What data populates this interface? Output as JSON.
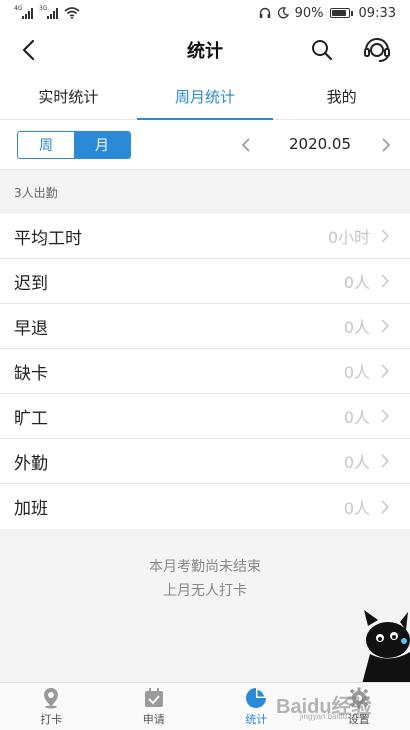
{
  "status_bar": {
    "network_1": "4G",
    "network_2": "3G",
    "battery": "90%",
    "time": "09:33"
  },
  "header": {
    "title": "统计"
  },
  "tabs": [
    {
      "label": "实时统计",
      "active": false
    },
    {
      "label": "周月统计",
      "active": true
    },
    {
      "label": "我的",
      "active": false
    }
  ],
  "period": {
    "options": [
      {
        "label": "周",
        "selected": false
      },
      {
        "label": "月",
        "selected": true
      }
    ],
    "current": "2020.05"
  },
  "summary": {
    "heading": "3人出勤"
  },
  "rows": [
    {
      "label": "平均工时",
      "value": "0小时"
    },
    {
      "label": "迟到",
      "value": "0人"
    },
    {
      "label": "早退",
      "value": "0人"
    },
    {
      "label": "缺卡",
      "value": "0人"
    },
    {
      "label": "旷工",
      "value": "0人"
    },
    {
      "label": "外勤",
      "value": "0人"
    },
    {
      "label": "加班",
      "value": "0人"
    }
  ],
  "notice": {
    "line1": "本月考勤尚未结束",
    "line2": "上月无人打卡"
  },
  "tabbar": [
    {
      "label": "打卡",
      "icon": "location-pin-icon",
      "active": false
    },
    {
      "label": "申请",
      "icon": "calendar-check-icon",
      "active": false
    },
    {
      "label": "统计",
      "icon": "pie-chart-icon",
      "active": true
    },
    {
      "label": "设置",
      "icon": "gear-icon",
      "active": false
    }
  ],
  "watermark": {
    "text": "Baidu经验",
    "sub": "jingyan.baidu.com"
  },
  "colors": {
    "accent": "#2a8ad6",
    "muted_value": "#c6c6c6",
    "background": "#f4f4f4"
  }
}
